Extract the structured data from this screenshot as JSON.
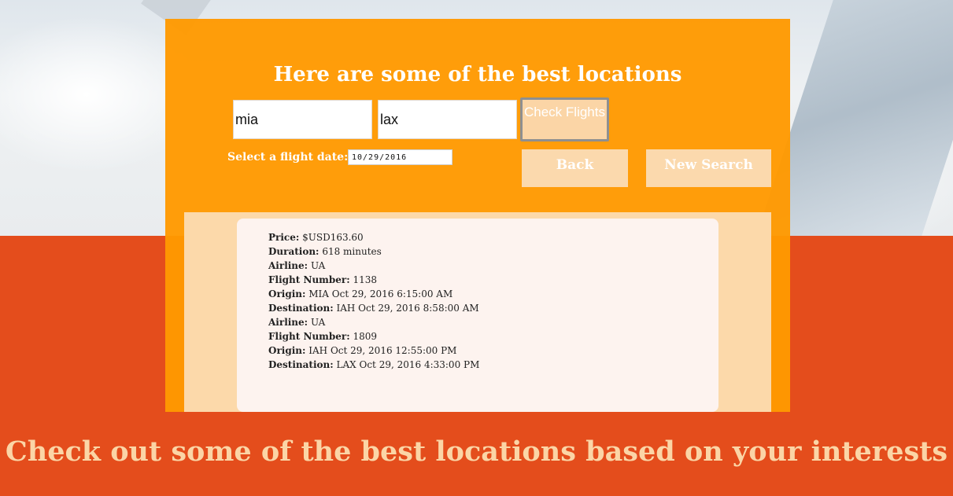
{
  "panel": {
    "title": "Here are some of the best locations",
    "origin_value": "mia",
    "destination_value": "lax",
    "check_button_label": "Check Flights",
    "date_label": "Select a flight date:",
    "date_value": "10/29/2016",
    "back_label": "Back",
    "new_search_label": "New Search"
  },
  "result": {
    "lines": [
      {
        "label": "Price:",
        "value": "$USD163.60"
      },
      {
        "label": "Duration:",
        "value": "618 minutes"
      },
      {
        "label": "Airline:",
        "value": "UA"
      },
      {
        "label": "Flight Number:",
        "value": "1138"
      },
      {
        "label": "Origin:",
        "value": "MIA Oct 29, 2016 6:15:00 AM"
      },
      {
        "label": "Destination:",
        "value": "IAH Oct 29, 2016 8:58:00 AM"
      },
      {
        "label": "Airline:",
        "value": "UA"
      },
      {
        "label": "Flight Number:",
        "value": "1809"
      },
      {
        "label": "Origin:",
        "value": "IAH Oct 29, 2016 12:55:00 PM"
      },
      {
        "label": "Destination:",
        "value": "LAX Oct 29, 2016 4:33:00 PM"
      }
    ]
  },
  "footer": {
    "title": "Check out some of the best locations based on your interests"
  },
  "colors": {
    "panel": "#ff9900",
    "band": "#e44d1c",
    "soft_button": "#fbd9ad",
    "footer_text": "#fbd5a6"
  }
}
